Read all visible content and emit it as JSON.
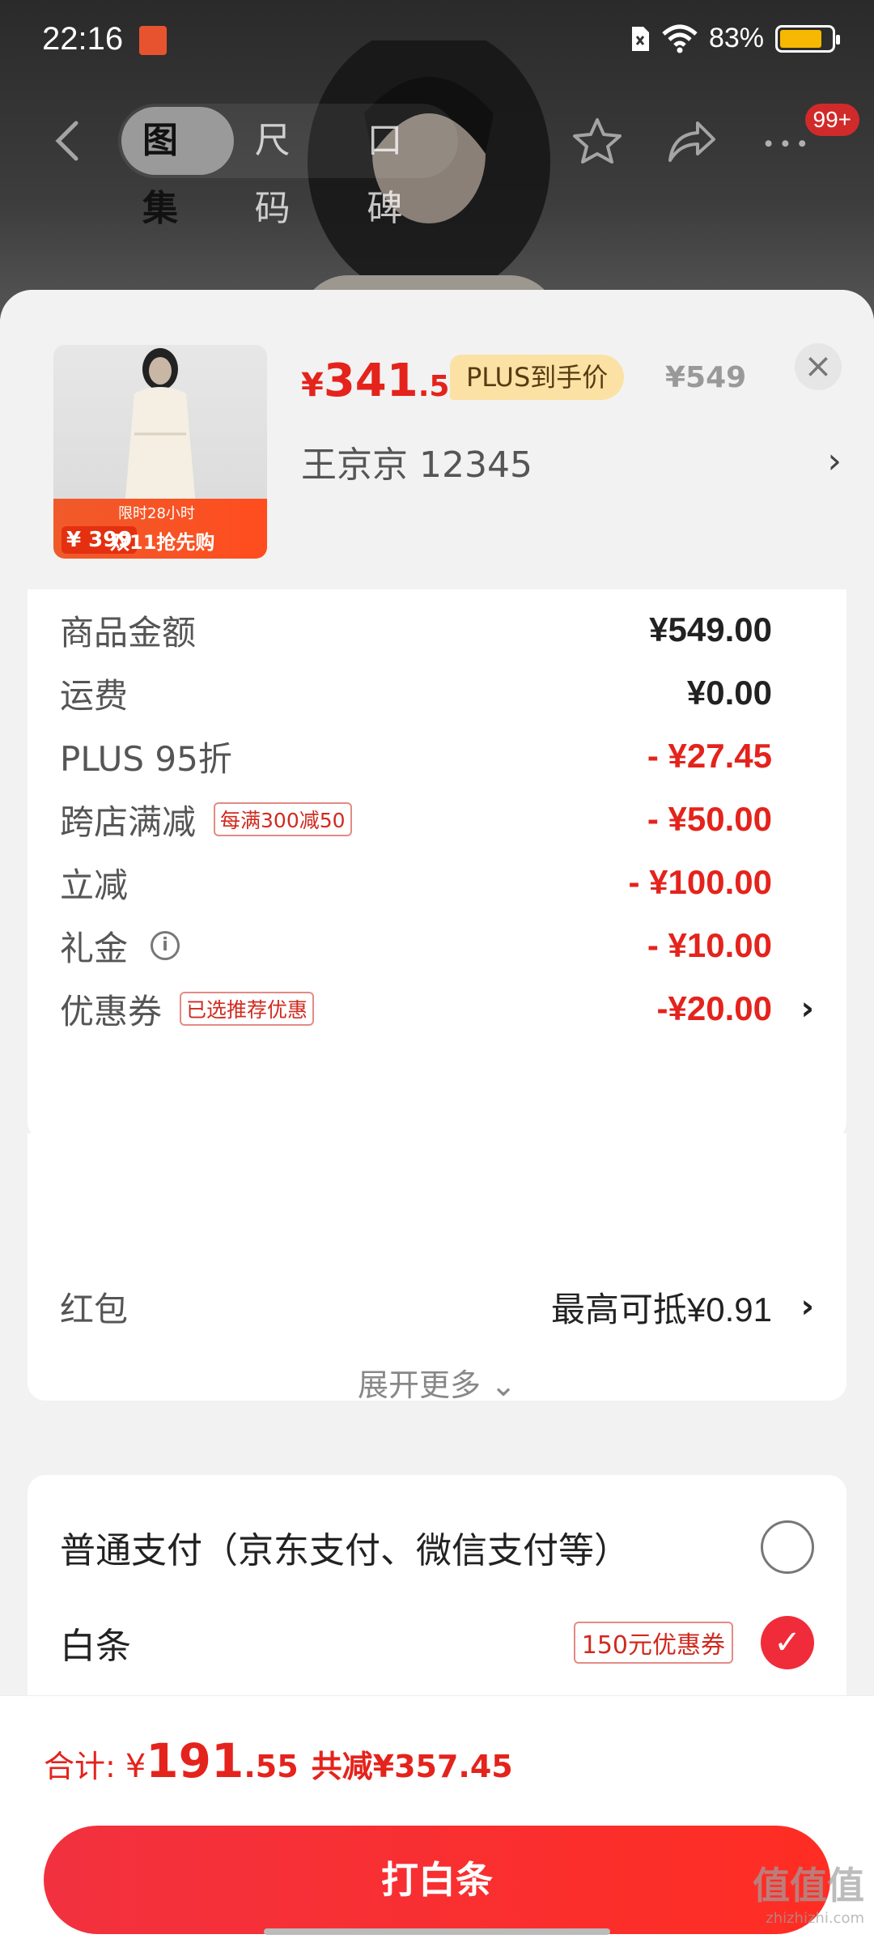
{
  "status_bar": {
    "time": "22:16",
    "battery": "83%"
  },
  "nav": {
    "tabs": [
      {
        "label": "图集",
        "active": true
      },
      {
        "label": "尺码",
        "active": false
      },
      {
        "label": "口碑",
        "active": false
      }
    ],
    "badge": "99+"
  },
  "product": {
    "price_currency": "¥",
    "price_int": "341",
    "price_dec": ".55",
    "plus_tag": "PLUS到手价",
    "original_price": "¥549",
    "variant": "王京京  12345",
    "thumb_labels": {
      "promo_time": "限时28小时",
      "promo_title": "双11抢先购",
      "promo_price": "¥ 399"
    }
  },
  "breakdown": {
    "rows": [
      {
        "label": "商品金额",
        "value": "¥549.00"
      },
      {
        "label": "运费",
        "value": "¥0.00"
      },
      {
        "label": "PLUS 95折",
        "value": "- ¥27.45"
      },
      {
        "label": "跨店满减",
        "tag": "每满300减50",
        "value": "- ¥50.00"
      },
      {
        "label": "立减",
        "value": "- ¥100.00"
      },
      {
        "label": "礼金",
        "value": "- ¥10.00"
      },
      {
        "label": "优惠券",
        "tag": "已选推荐优惠",
        "value": "-¥20.00"
      },
      {
        "label": "红包",
        "value": "最高可抵¥0.91"
      }
    ],
    "expand_label": "展开更多"
  },
  "payment": {
    "options": [
      {
        "label": "普通支付（京东支付、微信支付等）",
        "selected": false
      },
      {
        "label": "白条",
        "tag": "150元优惠券",
        "selected": true
      }
    ]
  },
  "footer": {
    "total_label": "合计:",
    "total_currency": "¥",
    "total_int": "191",
    "total_dec": ".55",
    "total_saved": "共减¥357.45",
    "pay_button": "打白条"
  },
  "watermark": {
    "brand": "值值值",
    "url": "zhizhizhi.com"
  },
  "colors": {
    "accent_red": "#e4231c",
    "plus_gold": "#fbe2a4",
    "button_red": "#f2313f"
  }
}
